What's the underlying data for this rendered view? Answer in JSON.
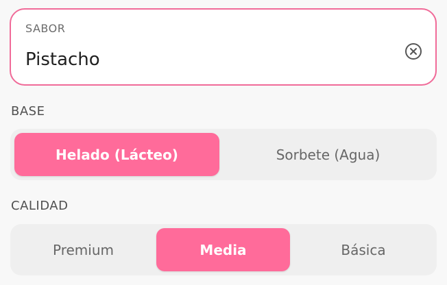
{
  "flavor_field": {
    "label": "SABOR",
    "value": "Pistacho",
    "clear_icon": "clear-circle-icon"
  },
  "base": {
    "title": "BASE",
    "options": [
      "Helado (Lácteo)",
      "Sorbete (Agua)"
    ],
    "selected": "Helado (Lácteo)"
  },
  "quality": {
    "title": "CALIDAD",
    "options": [
      "Premium",
      "Media",
      "Básica"
    ],
    "selected": "Media"
  },
  "colors": {
    "accent": "#ff6b9a",
    "field_border": "#f06a98",
    "segment_bg": "#efefef",
    "page_bg": "#f8f8f8"
  }
}
